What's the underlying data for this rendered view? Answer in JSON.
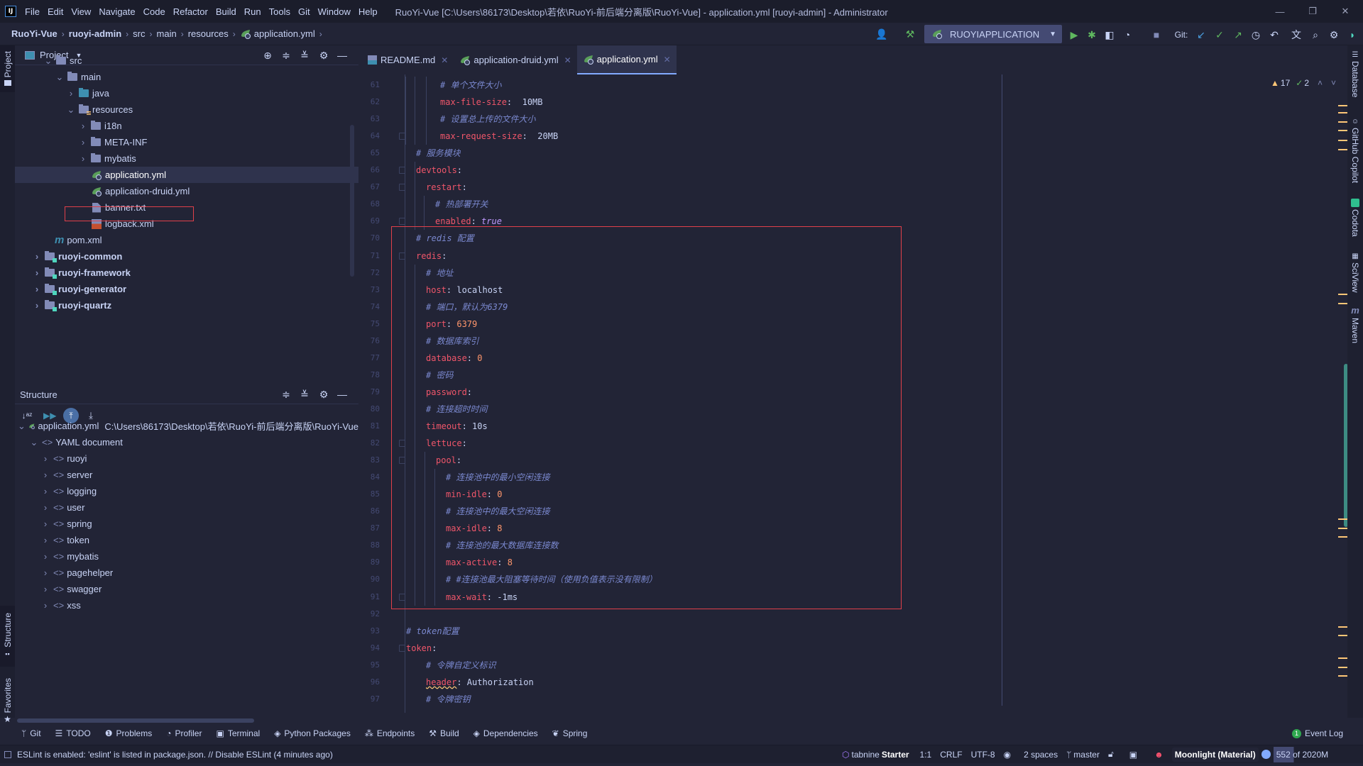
{
  "titlebar": {
    "logo": "IJ",
    "menu": [
      "File",
      "Edit",
      "View",
      "Navigate",
      "Code",
      "Refactor",
      "Build",
      "Run",
      "Tools",
      "Git",
      "Window",
      "Help"
    ],
    "window_title": "RuoYi-Vue [C:\\Users\\86173\\Desktop\\若依\\RuoYi-前后端分离版\\RuoYi-Vue] - application.yml [ruoyi-admin] - Administrator",
    "controls": {
      "minimize": "—",
      "restore": "❐",
      "close": "✕"
    }
  },
  "navbar": {
    "breadcrumbs": [
      "RuoYi-Vue",
      "ruoyi-admin",
      "src",
      "main",
      "resources",
      "application.yml"
    ],
    "run_config": "RUOYIAPPLICATION",
    "git_label": "Git:"
  },
  "left_stripe": {
    "project": "Project",
    "structure": "Structure",
    "favorites": "Favorites"
  },
  "project_panel": {
    "title": "Project",
    "tree": [
      {
        "label": "src",
        "depth": 2,
        "expanded": true,
        "type": "folder"
      },
      {
        "label": "main",
        "depth": 3,
        "expanded": true,
        "type": "folder"
      },
      {
        "label": "java",
        "depth": 4,
        "expanded": false,
        "type": "source-folder"
      },
      {
        "label": "resources",
        "depth": 4,
        "expanded": true,
        "type": "resources-folder"
      },
      {
        "label": "i18n",
        "depth": 5,
        "expanded": false,
        "type": "folder"
      },
      {
        "label": "META-INF",
        "depth": 5,
        "expanded": false,
        "type": "folder"
      },
      {
        "label": "mybatis",
        "depth": 5,
        "expanded": false,
        "type": "folder"
      },
      {
        "label": "application.yml",
        "depth": 5,
        "type": "spring-yml",
        "selected": true
      },
      {
        "label": "application-druid.yml",
        "depth": 5,
        "type": "spring-yml"
      },
      {
        "label": "banner.txt",
        "depth": 5,
        "type": "text"
      },
      {
        "label": "logback.xml",
        "depth": 5,
        "type": "xml"
      },
      {
        "label": "pom.xml",
        "depth": 3,
        "type": "maven"
      },
      {
        "label": "ruoyi-common",
        "depth": 1,
        "expanded": false,
        "type": "module"
      },
      {
        "label": "ruoyi-framework",
        "depth": 1,
        "expanded": false,
        "type": "module"
      },
      {
        "label": "ruoyi-generator",
        "depth": 1,
        "expanded": false,
        "type": "module"
      },
      {
        "label": "ruoyi-quartz",
        "depth": 1,
        "expanded": false,
        "type": "module"
      }
    ]
  },
  "structure_panel": {
    "title": "Structure",
    "root_file": "application.yml",
    "root_path": "C:\\Users\\86173\\Desktop\\若依\\RuoYi-前后端分离版\\RuoYi-Vue",
    "document": "YAML document",
    "keys": [
      "ruoyi",
      "server",
      "logging",
      "user",
      "spring",
      "token",
      "mybatis",
      "pagehelper",
      "swagger",
      "xss"
    ]
  },
  "editor": {
    "tabs": [
      {
        "label": "README.md",
        "active": false
      },
      {
        "label": "application-druid.yml",
        "active": false
      },
      {
        "label": "application.yml",
        "active": true
      }
    ],
    "inspections": {
      "warnings": "17",
      "weak_warnings": "2"
    },
    "lines": [
      {
        "n": "61",
        "indent": 3,
        "parts": [
          [
            "c",
            "# 单个文件大小"
          ]
        ]
      },
      {
        "n": "62",
        "indent": 3,
        "parts": [
          [
            "k",
            "max-file-size"
          ],
          [
            "v",
            ":  10MB"
          ]
        ]
      },
      {
        "n": "63",
        "indent": 3,
        "parts": [
          [
            "c",
            "# 设置总上传的文件大小"
          ]
        ]
      },
      {
        "n": "64",
        "indent": 3,
        "parts": [
          [
            "k",
            "max-request-size"
          ],
          [
            "v",
            ":  20MB"
          ]
        ]
      },
      {
        "n": "65",
        "indent": 1,
        "parts": [
          [
            "c",
            "# 服务模块"
          ]
        ]
      },
      {
        "n": "66",
        "indent": 1,
        "parts": [
          [
            "k",
            "devtools"
          ],
          [
            "v",
            ":"
          ]
        ]
      },
      {
        "n": "67",
        "indent": 2,
        "parts": [
          [
            "k",
            "restart"
          ],
          [
            "v",
            ":"
          ]
        ]
      },
      {
        "n": "68",
        "indent": 3,
        "parts": [
          [
            "c",
            "# 热部署开关"
          ]
        ]
      },
      {
        "n": "69",
        "indent": 3,
        "parts": [
          [
            "k",
            "enabled"
          ],
          [
            "v",
            ": "
          ],
          [
            "b",
            "true"
          ]
        ]
      },
      {
        "n": "70",
        "indent": 1,
        "parts": [
          [
            "c",
            "# redis 配置"
          ]
        ]
      },
      {
        "n": "71",
        "indent": 1,
        "parts": [
          [
            "k",
            "redis"
          ],
          [
            "v",
            ":"
          ]
        ]
      },
      {
        "n": "72",
        "indent": 2,
        "parts": [
          [
            "c",
            "# 地址"
          ]
        ]
      },
      {
        "n": "73",
        "indent": 2,
        "parts": [
          [
            "k",
            "host"
          ],
          [
            "v",
            ": localhost"
          ]
        ]
      },
      {
        "n": "74",
        "indent": 2,
        "parts": [
          [
            "c",
            "# 端口，默认为6379"
          ]
        ]
      },
      {
        "n": "75",
        "indent": 2,
        "parts": [
          [
            "k",
            "port"
          ],
          [
            "v",
            ": "
          ],
          [
            "n",
            "6379"
          ]
        ]
      },
      {
        "n": "76",
        "indent": 2,
        "parts": [
          [
            "c",
            "# 数据库索引"
          ]
        ]
      },
      {
        "n": "77",
        "indent": 2,
        "parts": [
          [
            "k",
            "database"
          ],
          [
            "v",
            ": "
          ],
          [
            "n",
            "0"
          ]
        ]
      },
      {
        "n": "78",
        "indent": 2,
        "parts": [
          [
            "c",
            "# 密码"
          ]
        ]
      },
      {
        "n": "79",
        "indent": 2,
        "parts": [
          [
            "k",
            "password"
          ],
          [
            "v",
            ":"
          ]
        ]
      },
      {
        "n": "80",
        "indent": 2,
        "parts": [
          [
            "c",
            "# 连接超时时间"
          ]
        ]
      },
      {
        "n": "81",
        "indent": 2,
        "parts": [
          [
            "k",
            "timeout"
          ],
          [
            "v",
            ": 10s"
          ]
        ]
      },
      {
        "n": "82",
        "indent": 2,
        "parts": [
          [
            "k",
            "lettuce"
          ],
          [
            "v",
            ":"
          ]
        ]
      },
      {
        "n": "83",
        "indent": 3,
        "parts": [
          [
            "k",
            "pool"
          ],
          [
            "v",
            ":"
          ]
        ]
      },
      {
        "n": "84",
        "indent": 4,
        "parts": [
          [
            "c",
            "# 连接池中的最小空闲连接"
          ]
        ]
      },
      {
        "n": "85",
        "indent": 4,
        "parts": [
          [
            "k",
            "min-idle"
          ],
          [
            "v",
            ": "
          ],
          [
            "n",
            "0"
          ]
        ]
      },
      {
        "n": "86",
        "indent": 4,
        "parts": [
          [
            "c",
            "# 连接池中的最大空闲连接"
          ]
        ]
      },
      {
        "n": "87",
        "indent": 4,
        "parts": [
          [
            "k",
            "max-idle"
          ],
          [
            "v",
            ": "
          ],
          [
            "n",
            "8"
          ]
        ]
      },
      {
        "n": "88",
        "indent": 4,
        "parts": [
          [
            "c",
            "# 连接池的最大数据库连接数"
          ]
        ]
      },
      {
        "n": "89",
        "indent": 4,
        "parts": [
          [
            "k",
            "max-active"
          ],
          [
            "v",
            ": "
          ],
          [
            "n",
            "8"
          ]
        ]
      },
      {
        "n": "90",
        "indent": 4,
        "parts": [
          [
            "c",
            "# #连接池最大阻塞等待时间（使用负值表示没有限制）"
          ]
        ]
      },
      {
        "n": "91",
        "indent": 4,
        "parts": [
          [
            "k",
            "max-wait"
          ],
          [
            "v",
            ": -1ms"
          ]
        ]
      },
      {
        "n": "92",
        "indent": 0,
        "parts": []
      },
      {
        "n": "93",
        "indent": 0,
        "parts": [
          [
            "c",
            "# token配置"
          ]
        ]
      },
      {
        "n": "94",
        "indent": 0,
        "parts": [
          [
            "k",
            "token"
          ],
          [
            "v",
            ":"
          ]
        ]
      },
      {
        "n": "95",
        "indent": 2,
        "parts": [
          [
            "c",
            "# 令牌自定义标识"
          ]
        ]
      },
      {
        "n": "96",
        "indent": 2,
        "parts": [
          [
            "k",
            "header"
          ],
          [
            "v",
            ": Authorization"
          ]
        ]
      },
      {
        "n": "97",
        "indent": 2,
        "parts": [
          [
            "c",
            "# 令牌密钥"
          ]
        ]
      }
    ]
  },
  "right_stripe": [
    "Database",
    "GitHub Copilot",
    "Codota",
    "SciView",
    "Maven"
  ],
  "bottom_tools": [
    "Git",
    "TODO",
    "Problems",
    "Profiler",
    "Terminal",
    "Python Packages",
    "Endpoints",
    "Build",
    "Dependencies",
    "Spring"
  ],
  "event_log": {
    "count": "1",
    "label": "Event Log"
  },
  "statusbar": {
    "message": "ESLint is enabled: 'eslint' is listed in package.json. // Disable ESLint (4 minutes ago)",
    "tabnine": "tabnine",
    "tabnine_plan": "Starter",
    "position": "1:1",
    "line_sep": "CRLF",
    "encoding": "UTF-8",
    "indent": "2 spaces",
    "branch": "master",
    "theme": "Moonlight (Material)",
    "memory": "552 of 2020M"
  }
}
